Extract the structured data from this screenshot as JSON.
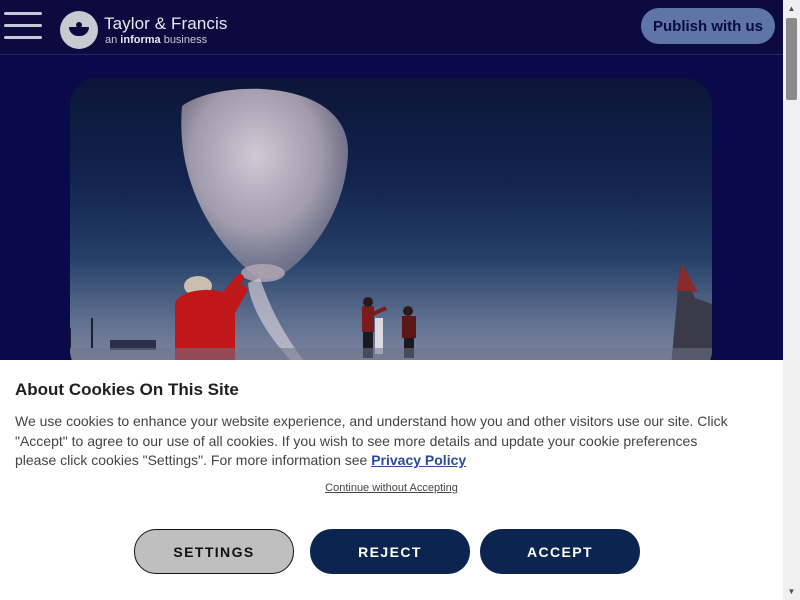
{
  "header": {
    "logo_title": "Taylor & Francis",
    "logo_sub_prefix": "an ",
    "logo_sub_brand": "informa",
    "logo_sub_suffix": " business",
    "publish_label": "Publish with us"
  },
  "cookie": {
    "title": "About Cookies On This Site",
    "body": "We use cookies to enhance your website experience, and understand how you and other visitors use our site. Click \"Accept\" to agree to our use of all cookies. If you wish to see more details and update your cookie preferences please click cookies \"Settings\". For more information see ",
    "privacy_link": "Privacy Policy",
    "continue_link": "Continue without Accepting",
    "settings_label": "SETTINGS",
    "reject_label": "REJECT",
    "accept_label": "ACCEPT"
  },
  "icons": {
    "menu": "hamburger-icon",
    "logo": "taylor-francis-logo",
    "scroll_up": "chevron-up-icon",
    "scroll_down": "chevron-down-icon"
  },
  "colors": {
    "header_bg": "#0b0b3f",
    "publish_button": "#5f74a8",
    "primary_button": "#0b2550",
    "link": "#2a4b9b"
  }
}
